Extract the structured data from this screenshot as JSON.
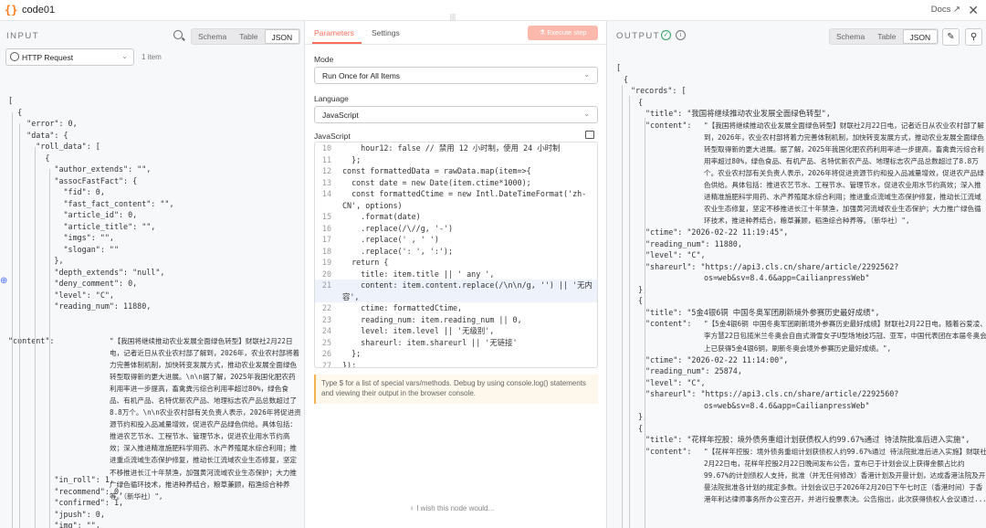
{
  "header": {
    "node_icon": "{}",
    "title": "code01",
    "docs": "Docs",
    "docs_icon": "↗",
    "close": "✕"
  },
  "input": {
    "label": "INPUT",
    "views": [
      "Schema",
      "Table",
      "JSON"
    ],
    "active_view": "JSON",
    "source": "HTTP Request",
    "item_count": "1 item",
    "json_lines": [
      "[",
      "  {",
      "    \"error\": 0,",
      "    \"data\": {",
      "      \"roll_data\": [",
      "        {",
      "          \"author_extends\": \"\",",
      "          \"assocFastFact\": {",
      "            \"fid\": 0,",
      "            \"fast_fact_content\": \"\",",
      "            \"article_id\": 0,",
      "            \"article_title\": \"\",",
      "            \"imgs\": \"\",",
      "            \"slogan\": \"\"",
      "          },",
      "          \"depth_extends\": \"null\",",
      "          \"deny_comment\": 0,",
      "          \"level\": \"C\",",
      "          \"reading_num\": 11880,"
    ],
    "content_key": "\"content\":",
    "content_text": "\"【我国将继续推动农业发展全面绿色转型】财联社2月22日电，记者近日从农业农村部了解到，2026年，农业农村部将着力完善体制机制，加快转变发展方式，推动农业发展全面绿色转型取得新的更大进展。\\n\\n据了解，2025年我国化肥农药利用率进一步提高，畜禽粪污综合利用率超过80%，绿色食品、有机产品、名特优新农产品、地理标志农产品总数超过了8.8万个。\\n\\n农业农村部有关负责人表示，2026年将促进资源节约和投入品减量增效，促进农产品绿色供给。具体包括：推进农艺节水、工程节水、管理节水，促进农业用水节约高效；深入推进精准施肥科学用药、水产养殖尾水综合利用；推进重点流域生态保护修复，推动长江流域农业生态修复，坚定不移推进长江十年禁渔，加强黄河流域农业生态保护；大力推广绿色循环技术，推进种养结合，粮草兼顾，稻渔综合种养等。（新华社）\",",
    "tail_lines": [
      "          \"in_roll\": 1,",
      "          \"recommend\": 0,",
      "          \"confirmed\": 1,",
      "          \"jpush\": 0,",
      "          \"img\": \"\","
    ]
  },
  "params": {
    "tabs": [
      "Parameters",
      "Settings"
    ],
    "execute": "Execute step",
    "mode_label": "Mode",
    "mode_value": "Run Once for All Items",
    "language_label": "Language",
    "language_value": "JavaScript",
    "code_label": "JavaScript",
    "hint": "Type $ for a list of special vars/methods. Debug by using console.log() statements and viewing their output in the browser console.",
    "hint_link": "special vars/methods",
    "wish": "I wish this node would...",
    "code_lines": [
      {
        "n": "10",
        "t": "    hour12: false // 禁用 12 小时制，使用 24 小时制"
      },
      {
        "n": "11",
        "t": "  };"
      },
      {
        "n": "12",
        "t": "const formattedData = rawData.map(item=>{"
      },
      {
        "n": "13",
        "t": "  const date = new Date(item.ctime*1000);"
      },
      {
        "n": "14",
        "t": "  const formattedCtime = new Intl.DateTimeFormat('zh-"
      },
      {
        "n": "",
        "t": "CN', options)"
      },
      {
        "n": "15",
        "t": "    .format(date)"
      },
      {
        "n": "16",
        "t": "    .replace(/\\//g, '-')"
      },
      {
        "n": "17",
        "t": "    .replace(' , ' ')"
      },
      {
        "n": "18",
        "t": "    .replace(': ', ':');"
      },
      {
        "n": "19",
        "t": "  return {"
      },
      {
        "n": "20",
        "t": "    title: item.title || ' any ',"
      },
      {
        "n": "21",
        "t": "    content: item.content.replace(/\\n\\n/g, '') || '无内"
      },
      {
        "n": "",
        "t": "容',"
      },
      {
        "n": "22",
        "t": "    ctime: formattedCtime,"
      },
      {
        "n": "23",
        "t": "    reading_num: item.reading_num || 0,"
      },
      {
        "n": "24",
        "t": "    level: item.level || '无级别',"
      },
      {
        "n": "25",
        "t": "    shareurl: item.shareurl || '无链接'"
      },
      {
        "n": "26",
        "t": "  };"
      },
      {
        "n": "27",
        "t": "});"
      }
    ]
  },
  "output": {
    "label": "OUTPUT",
    "views": [
      "Schema",
      "Table",
      "JSON"
    ],
    "active_view": "JSON",
    "records": [
      {
        "title": "\"我国将继续推动农业发展全面绿色转型\",",
        "content": "\"【我国将继续推动农业发展全面绿色转型】财联社2月22日电，记者近日从农业农村部了解到，2026年，农业农村部将着力完善体制机制，加快转变发展方式，推动农业发展全面绿色转型取得新的更大进展。据了解，2025年我国化肥农药利用率进一步提高，畜禽粪污综合利用率超过80%，绿色食品、有机产品、名特优新农产品、地理标志农产品总数超过了8.8万个。农业农村部有关负责人表示，2026年将促进资源节约和投入品减量增效，促进农产品绿色供给。具体包括：推进农艺节水、工程节水、管理节水，促进农业用水节约高效；深入推进精准施肥科学用药、水产养殖尾水综合利用；推进重点流域生态保护修复，推动长江流域农业生态修复，坚定不移推进长江十年禁渔，加强黄河流域农业生态保护；大力推广绿色循环技术，推进种养结合，粮草兼顾，稻渔综合种养等。（新华社）\",",
        "ctime": "\"2026-02-22 11:19:45\",",
        "reading_num": "11880,",
        "level": "\"C\",",
        "shareurl_1": "\"https://api3.cls.cn/share/article/2292562?",
        "shareurl_2": "os=web&sv=8.4.6&app=CailianpressWeb\""
      },
      {
        "title": "\"5金4银6铜 中国冬奥军团刷新境外参赛历史最好成绩\",",
        "content": "\"【5金4银6铜 中国冬奥军团刷新境外参赛历史最好成绩】财联社2月22日电，随着谷爱凌、李方慧22日包揽米兰冬奥会自由式滑雪女子U型场地技巧冠、亚军，中国代表团在本届冬奥会上已获得5金4银6铜，刷新冬奥会境外参赛历史最好成绩。\",",
        "ctime": "\"2026-02-22 11:14:00\",",
        "reading_num": "25874,",
        "level": "\"C\",",
        "shareurl_1": "\"https://api3.cls.cn/share/article/2292560?",
        "shareurl_2": "os=web&sv=8.4.6&app=CailianpressWeb\""
      },
      {
        "title": "\"花样年控股：境外债务重组计划获债权人约99.67%通过 待法院批准后进入实施\",",
        "content": "\"【花样年控股：境外债务重组计划获债权人约99.67%通过 待法院批准后进入实施】财联社2月22日电，花样年控股2月22日晚间发布公告，宣布已于计划会议上获得金额占比约99.67%的计划债权人支持，批准（并无任何修改）香港计划及开曼计划，达成香港法院及开曼法院批准各计划的规定多数。计划会议已于2026年2月20日下午七时正（香港时间）于香港年利达律师事务所办公室召开，并进行投票表决。公告指出，此次获得债权人会议通过..."
      }
    ]
  }
}
